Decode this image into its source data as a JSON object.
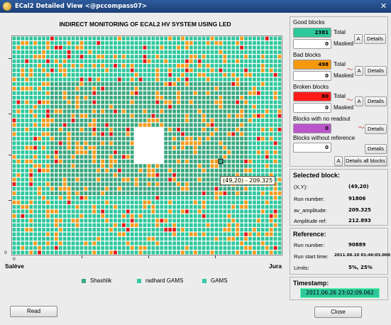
{
  "window": {
    "title": "ECal2 Detailed View <@pccompass07>",
    "close_glyph": "✕"
  },
  "plot": {
    "title": "INDIRECT MONITORING OF ECAL2 HV SYSTEM USING LED",
    "left_label": "Salève",
    "right_label": "Jura",
    "tooltip": "(49,20) - 209.325",
    "zero_label": "0",
    "y_ticks": [
      "0",
      "",
      "",
      "",
      "",
      "",
      ""
    ],
    "legend": [
      {
        "label": "Shashlik",
        "color": "#3aa880"
      },
      {
        "label": "radhard GAMS",
        "color": "#32c8a4"
      },
      {
        "label": "GAMS",
        "color": "#32c8a4"
      }
    ]
  },
  "chart_data": {
    "type": "heatmap",
    "title": "INDIRECT MONITORING OF ECAL2 HV SYSTEM USING LED",
    "x_range": [
      0,
      64
    ],
    "y_range": [
      0,
      48
    ],
    "hole": {
      "x": [
        29,
        36
      ],
      "y": [
        20,
        28
      ]
    },
    "selected_cell": {
      "x": 49,
      "y": 20,
      "value": 209.325
    },
    "status_colors": {
      "good": "#2fc79c",
      "bad": "#f39b1c",
      "broken": "#e01818"
    },
    "counts": {
      "good": 2381,
      "bad": 498,
      "broken": 80
    }
  },
  "blocks": {
    "good": {
      "title": "Good blocks",
      "total": "2381",
      "total_label": "Total",
      "masked": "0",
      "masked_label": "Masked",
      "color": "#2fc79c"
    },
    "bad": {
      "title": "Bad blocks",
      "total": "498",
      "total_label": "Total",
      "masked": "0",
      "masked_label": "Masked",
      "color": "#f5980e"
    },
    "broken": {
      "title": "Broken blocks",
      "total": "80",
      "total_label": "Total",
      "masked": "0",
      "masked_label": "Masked",
      "color": "#ff1a1a"
    },
    "no_readout": {
      "title": "Blocks with no readout",
      "value": "0",
      "color": "#bb55cc"
    },
    "no_reference": {
      "title": "Blocks without reference",
      "value": "0"
    },
    "a_label": "A",
    "details_label": "Details",
    "details_all_label": "Details all blocks"
  },
  "selected": {
    "title": "Selected block:",
    "rows": [
      {
        "key": "(X,Y):",
        "value": "(49,20)"
      },
      {
        "key": "Run number:",
        "value": "91806"
      },
      {
        "key": "av_amplitude:",
        "value": "209.325"
      },
      {
        "key": "Amplitude ref:",
        "value": "212.893"
      }
    ]
  },
  "reference": {
    "title": "Reference:",
    "rows": [
      {
        "key": "Run number:",
        "value": "90889"
      },
      {
        "key": "Run start time:",
        "value": "2011.06.10 01:46:03.000"
      },
      {
        "key": "Limits:",
        "value": "5%, 25%"
      }
    ]
  },
  "timestamp": {
    "title": "Timestamp:",
    "value": "2011.06.26 23:02:09.062",
    "color": "#2fc79c"
  },
  "buttons": {
    "read": "Read",
    "close": "Close"
  }
}
